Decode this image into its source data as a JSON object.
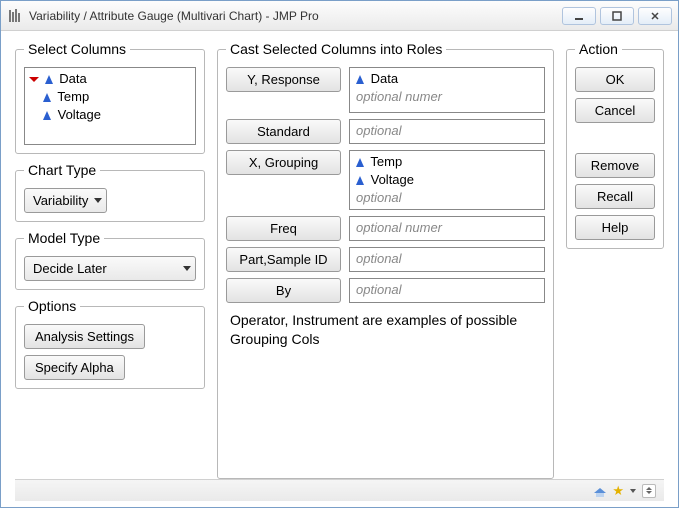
{
  "window": {
    "title": "Variability / Attribute Gauge (Multivari Chart) - JMP Pro"
  },
  "select_columns": {
    "legend": "Select Columns",
    "items": [
      "Data",
      "Temp",
      "Voltage"
    ]
  },
  "chart_type": {
    "legend": "Chart Type",
    "value": "Variability"
  },
  "model_type": {
    "legend": "Model Type",
    "value": "Decide Later"
  },
  "options": {
    "legend": "Options",
    "analysis_settings": "Analysis Settings",
    "specify_alpha": "Specify Alpha"
  },
  "roles": {
    "legend": "Cast Selected Columns into Roles",
    "y": {
      "button": "Y, Response",
      "items": [
        "Data"
      ],
      "placeholder": "optional numer"
    },
    "standard": {
      "button": "Standard",
      "placeholder": "optional"
    },
    "x": {
      "button": "X, Grouping",
      "items": [
        "Temp",
        "Voltage"
      ],
      "placeholder": "optional"
    },
    "freq": {
      "button": "Freq",
      "placeholder": "optional numer"
    },
    "part": {
      "button": "Part,Sample ID",
      "placeholder": "optional"
    },
    "by": {
      "button": "By",
      "placeholder": "optional"
    },
    "hint": "Operator, Instrument are examples of possible Grouping Cols"
  },
  "action": {
    "legend": "Action",
    "ok": "OK",
    "cancel": "Cancel",
    "remove": "Remove",
    "recall": "Recall",
    "help": "Help"
  }
}
